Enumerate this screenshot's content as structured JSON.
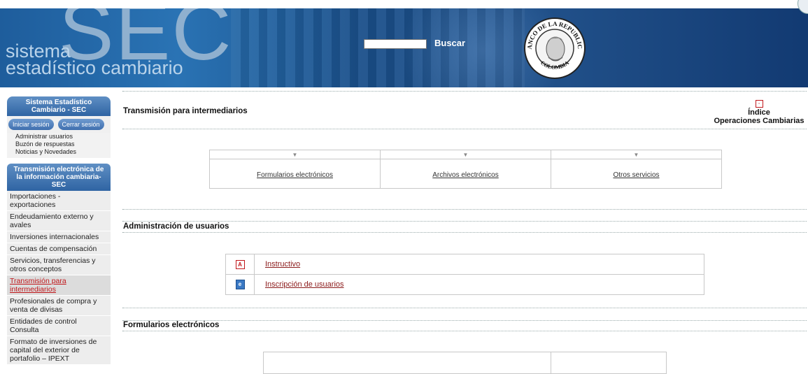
{
  "header": {
    "logo_big": "SEC",
    "logo_line1": "sistema",
    "logo_line2": "estadístico cambiario",
    "search_placeholder": "",
    "search_button": "Buscar",
    "seal_top": "BANCO DE LA REPUBLICA",
    "seal_bottom": "COLOMBIA"
  },
  "sidebar": {
    "title": "Sistema Estadístico Cambiario - SEC",
    "login_button": "Iniciar sesión",
    "logout_button": "Cerrar sesión",
    "links": [
      "Administrar usuarios",
      "Buzón de respuestas",
      "Noticias y Novedades"
    ],
    "section_title": "Transmisión electrónica de la información cambiaria- SEC",
    "items": [
      "Importaciones - exportaciones",
      "Endeudamiento externo y avales",
      "Inversiones internacionales",
      "Cuentas de compensación",
      "Servicios, transferencias y otros conceptos",
      "Transmisión para intermediarios",
      "Profesionales de compra y venta de divisas",
      "Entidades de control Consulta",
      "Formato de inversiones de capital del exterior de portafolio – IPEXT"
    ],
    "active_index": 5
  },
  "main": {
    "page_title": "Transmisión para intermediarios",
    "indice_line1": "Índice",
    "indice_line2": "Operaciones Cambiarias",
    "tabs": [
      "Formularios electrónicos",
      "Archivos electrónicos",
      "Otros servicios"
    ],
    "section_admin": "Administración de usuarios",
    "admin_links": [
      "Instructivo",
      "Inscripción de usuarios"
    ],
    "section_forms": "Formularios electrónicos"
  },
  "icons": {
    "pdf": "pdf-icon",
    "doc": "document-icon",
    "arrow": "triangle-down-icon"
  },
  "colors": {
    "header_blue": "#1e5d9c",
    "nav_blue": "#3f6fae",
    "link_red": "#8b1a1a",
    "active_red": "#c0161a"
  }
}
